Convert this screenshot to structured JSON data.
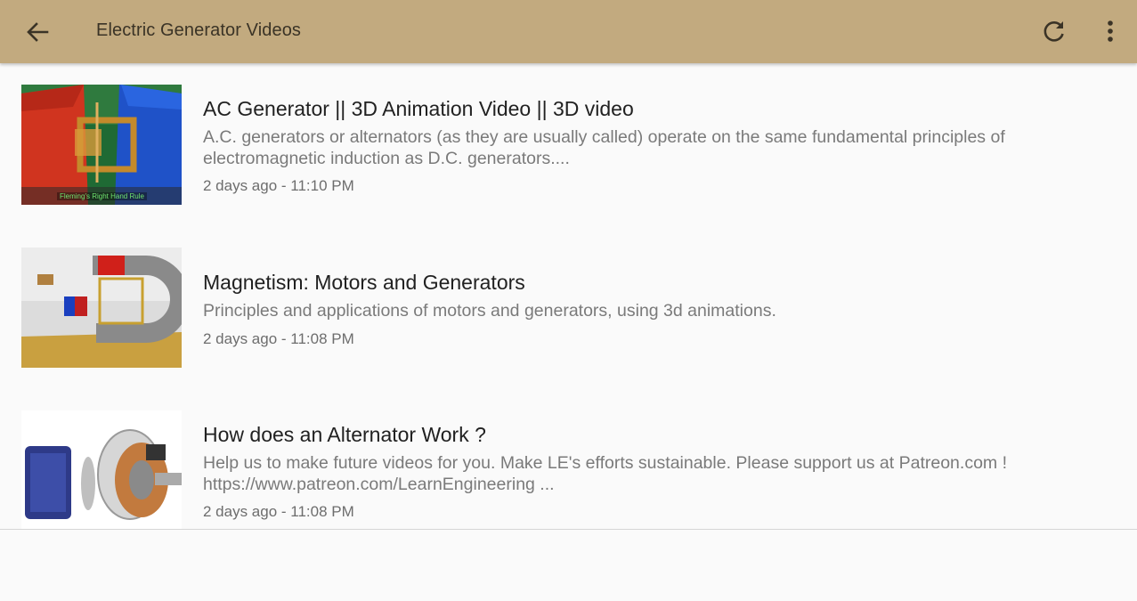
{
  "appbar": {
    "title": "Electric Generator Videos",
    "back_icon": "arrow-back-icon",
    "refresh_icon": "refresh-icon",
    "more_icon": "more-vert-icon",
    "color": "#c2aa7f"
  },
  "videos": [
    {
      "title": "AC Generator || 3D Animation Video || 3D video",
      "description": "A.C. generators or alternators (as they are usually called) operate on the same fundamental principles of electromagnetic induction as D.C. generators....",
      "date": "2 days ago - 11:10 PM",
      "thumb_caption": "Fleming's Right Hand Rule"
    },
    {
      "title": "Magnetism: Motors and Generators",
      "description": "Principles and applications of motors and generators, using 3d animations.",
      "date": "2 days ago - 11:08 PM"
    },
    {
      "title": "How does an Alternator Work ?",
      "description": "Help us to make future videos for you. Make LE's efforts sustainable. Please support us at Patreon.com ! https://www.patreon.com/LearnEngineering ...",
      "date": "2 days ago - 11:08 PM"
    }
  ]
}
